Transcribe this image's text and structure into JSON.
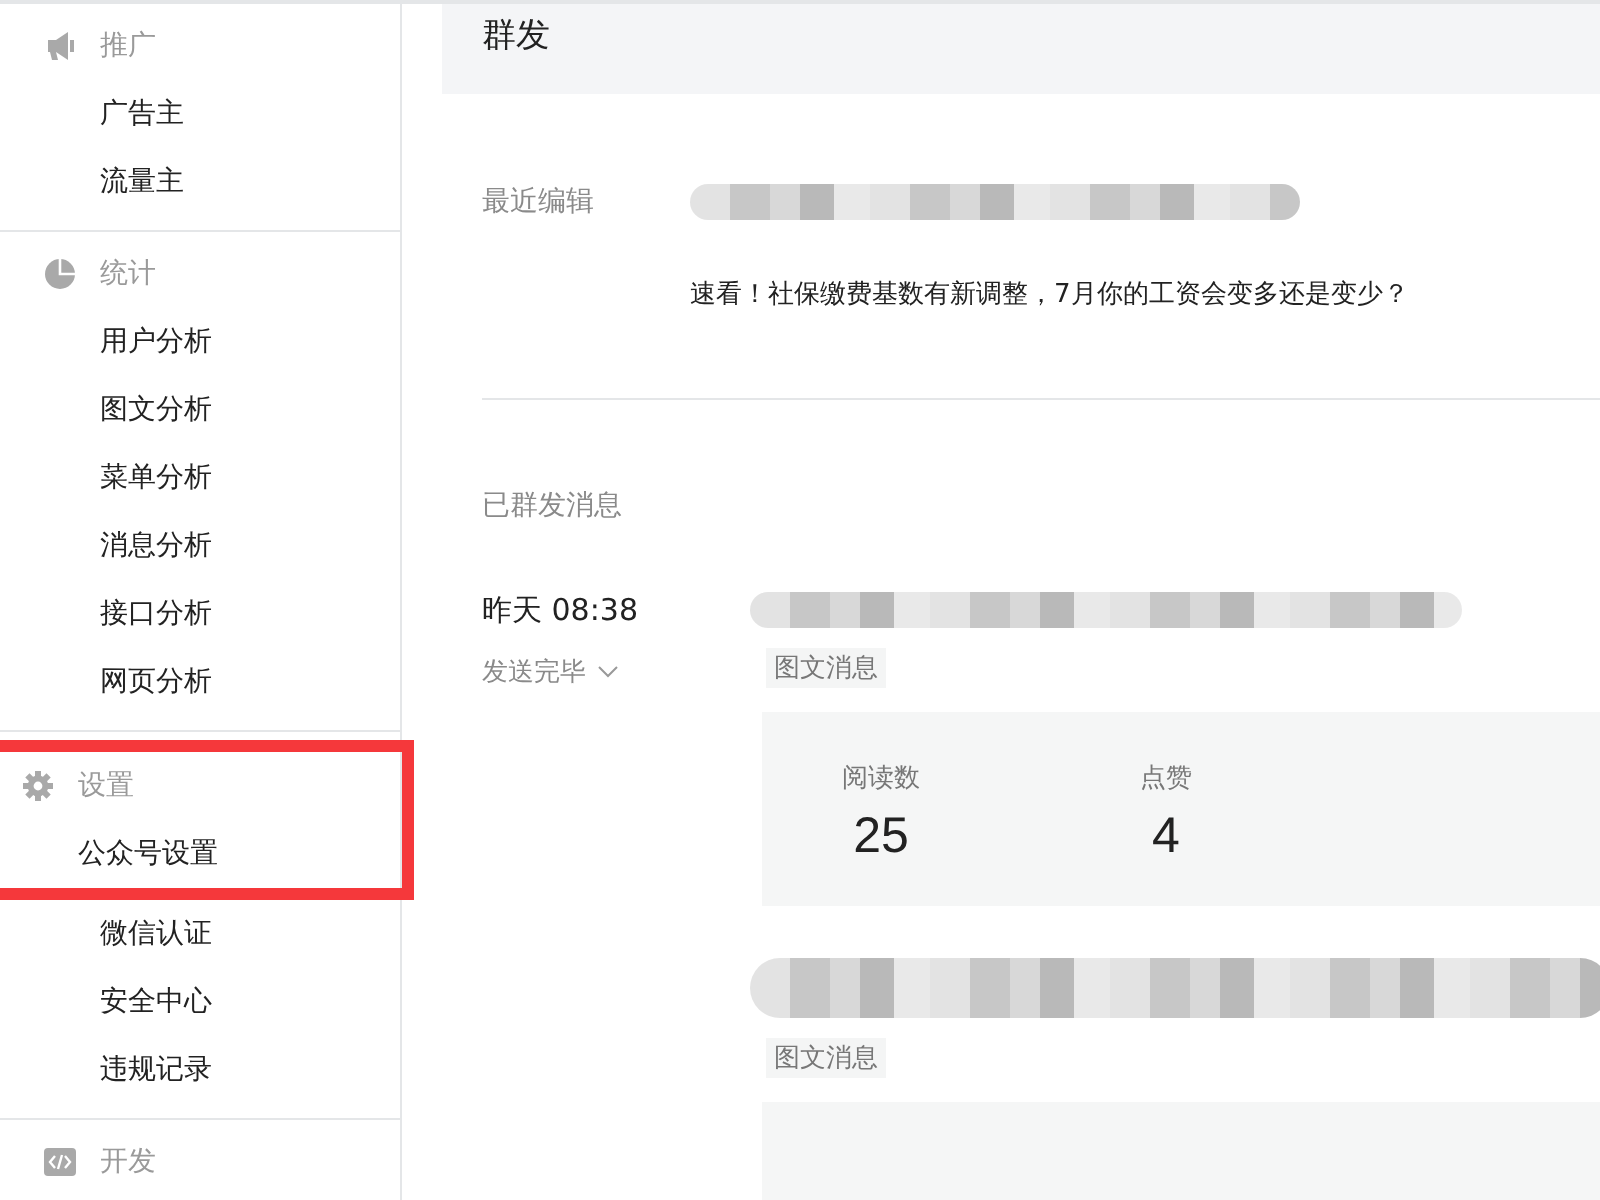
{
  "sidebar": {
    "sections": [
      {
        "header": {
          "label": "推广",
          "kind": "megaphone",
          "highlighted": false
        },
        "items": [
          {
            "label": "广告主",
            "highlighted": false
          },
          {
            "label": "流量主",
            "highlighted": false
          }
        ]
      },
      {
        "header": {
          "label": "统计",
          "kind": "pie",
          "highlighted": false
        },
        "items": [
          {
            "label": "用户分析",
            "highlighted": false
          },
          {
            "label": "图文分析",
            "highlighted": false
          },
          {
            "label": "菜单分析",
            "highlighted": false
          },
          {
            "label": "消息分析",
            "highlighted": false
          },
          {
            "label": "接口分析",
            "highlighted": false
          },
          {
            "label": "网页分析",
            "highlighted": false
          }
        ]
      },
      {
        "header": {
          "label": "设置",
          "kind": "gear",
          "highlighted": true
        },
        "items": [
          {
            "label": "公众号设置",
            "highlighted": true
          },
          {
            "label": "微信认证",
            "highlighted": false
          },
          {
            "label": "安全中心",
            "highlighted": false
          },
          {
            "label": "违规记录",
            "highlighted": false
          }
        ]
      },
      {
        "header": {
          "label": "开发",
          "kind": "code",
          "highlighted": false
        }
      }
    ]
  },
  "page": {
    "title": "群发",
    "recent": {
      "label": "最近编辑",
      "text": "速看！社保缴费基数有新调整，7月你的工资会变多还是变少？"
    },
    "sent": {
      "label": "已群发消息",
      "time": "昨天 08:38",
      "status": "发送完毕",
      "messages": [
        {
          "tag": "图文消息",
          "stats": [
            {
              "label": "阅读数",
              "value": "25"
            },
            {
              "label": "点赞",
              "value": "4"
            }
          ]
        },
        {
          "tag": "图文消息"
        }
      ]
    }
  }
}
